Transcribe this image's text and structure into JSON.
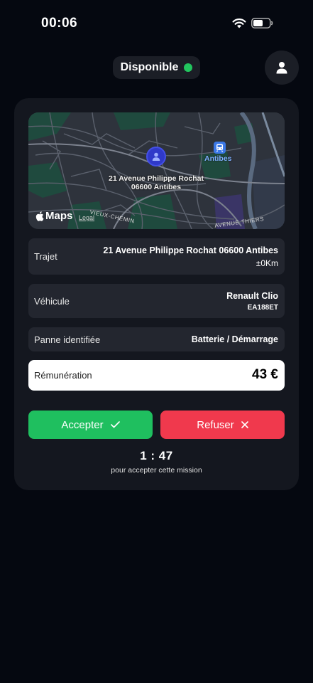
{
  "status_bar": {
    "time": "00:06",
    "icons": [
      "wifi-icon",
      "battery-icon"
    ]
  },
  "header": {
    "availability_label": "Disponible",
    "availability_color": "#22c55e",
    "profile_icon": "person-icon"
  },
  "map": {
    "address_label": "21 Avenue Philippe Rochat 06600 Antibes",
    "transit_label": "Antibes",
    "maps_label": "Maps",
    "legal_label": "Legal",
    "streets": [
      "VIEUX-CHEMIN",
      "AVENUE THIERS"
    ]
  },
  "mission": {
    "route": {
      "label": "Trajet",
      "address": "21 Avenue Philippe Rochat 06600 Antibes",
      "distance": "±0Km"
    },
    "vehicle": {
      "label": "Véhicule",
      "model": "Renault Clio",
      "plate": "EA188ET"
    },
    "breakdown": {
      "label": "Panne identifiée",
      "value": "Batterie / Démarrage"
    },
    "payment": {
      "label": "Rémunération",
      "amount": "43 €"
    }
  },
  "actions": {
    "accept_label": "Accepter",
    "refuse_label": "Refuser",
    "accept_color": "#1fbf5f",
    "refuse_color": "#f0394d"
  },
  "timer": {
    "countdown": "1 : 47",
    "caption": "pour accepter cette mission"
  }
}
